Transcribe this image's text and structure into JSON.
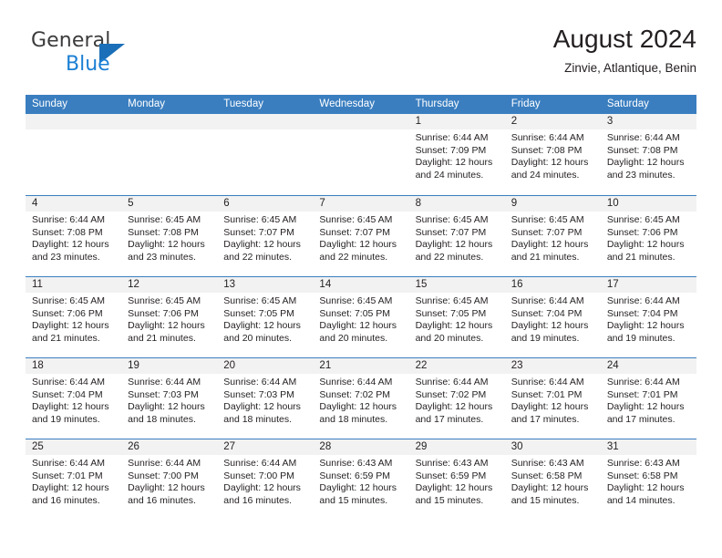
{
  "brand": {
    "name_part1": "General",
    "name_part2": "Blue",
    "accent_color": "#1b7fd4",
    "triangle_color": "#1b6fb8"
  },
  "header": {
    "title": "August 2024",
    "subtitle": "Zinvie, Atlantique, Benin"
  },
  "calendar": {
    "header_bg": "#3a7ec0",
    "weekdays": [
      "Sunday",
      "Monday",
      "Tuesday",
      "Wednesday",
      "Thursday",
      "Friday",
      "Saturday"
    ],
    "weeks": [
      [
        {
          "day": "",
          "empty": true,
          "sunrise": "",
          "sunset": "",
          "daylight1": "",
          "daylight2": ""
        },
        {
          "day": "",
          "empty": true,
          "sunrise": "",
          "sunset": "",
          "daylight1": "",
          "daylight2": ""
        },
        {
          "day": "",
          "empty": true,
          "sunrise": "",
          "sunset": "",
          "daylight1": "",
          "daylight2": ""
        },
        {
          "day": "",
          "empty": true,
          "sunrise": "",
          "sunset": "",
          "daylight1": "",
          "daylight2": ""
        },
        {
          "day": "1",
          "sunrise": "Sunrise: 6:44 AM",
          "sunset": "Sunset: 7:09 PM",
          "daylight1": "Daylight: 12 hours",
          "daylight2": "and 24 minutes."
        },
        {
          "day": "2",
          "sunrise": "Sunrise: 6:44 AM",
          "sunset": "Sunset: 7:08 PM",
          "daylight1": "Daylight: 12 hours",
          "daylight2": "and 24 minutes."
        },
        {
          "day": "3",
          "sunrise": "Sunrise: 6:44 AM",
          "sunset": "Sunset: 7:08 PM",
          "daylight1": "Daylight: 12 hours",
          "daylight2": "and 23 minutes."
        }
      ],
      [
        {
          "day": "4",
          "sunrise": "Sunrise: 6:44 AM",
          "sunset": "Sunset: 7:08 PM",
          "daylight1": "Daylight: 12 hours",
          "daylight2": "and 23 minutes."
        },
        {
          "day": "5",
          "sunrise": "Sunrise: 6:45 AM",
          "sunset": "Sunset: 7:08 PM",
          "daylight1": "Daylight: 12 hours",
          "daylight2": "and 23 minutes."
        },
        {
          "day": "6",
          "sunrise": "Sunrise: 6:45 AM",
          "sunset": "Sunset: 7:07 PM",
          "daylight1": "Daylight: 12 hours",
          "daylight2": "and 22 minutes."
        },
        {
          "day": "7",
          "sunrise": "Sunrise: 6:45 AM",
          "sunset": "Sunset: 7:07 PM",
          "daylight1": "Daylight: 12 hours",
          "daylight2": "and 22 minutes."
        },
        {
          "day": "8",
          "sunrise": "Sunrise: 6:45 AM",
          "sunset": "Sunset: 7:07 PM",
          "daylight1": "Daylight: 12 hours",
          "daylight2": "and 22 minutes."
        },
        {
          "day": "9",
          "sunrise": "Sunrise: 6:45 AM",
          "sunset": "Sunset: 7:07 PM",
          "daylight1": "Daylight: 12 hours",
          "daylight2": "and 21 minutes."
        },
        {
          "day": "10",
          "sunrise": "Sunrise: 6:45 AM",
          "sunset": "Sunset: 7:06 PM",
          "daylight1": "Daylight: 12 hours",
          "daylight2": "and 21 minutes."
        }
      ],
      [
        {
          "day": "11",
          "sunrise": "Sunrise: 6:45 AM",
          "sunset": "Sunset: 7:06 PM",
          "daylight1": "Daylight: 12 hours",
          "daylight2": "and 21 minutes."
        },
        {
          "day": "12",
          "sunrise": "Sunrise: 6:45 AM",
          "sunset": "Sunset: 7:06 PM",
          "daylight1": "Daylight: 12 hours",
          "daylight2": "and 21 minutes."
        },
        {
          "day": "13",
          "sunrise": "Sunrise: 6:45 AM",
          "sunset": "Sunset: 7:05 PM",
          "daylight1": "Daylight: 12 hours",
          "daylight2": "and 20 minutes."
        },
        {
          "day": "14",
          "sunrise": "Sunrise: 6:45 AM",
          "sunset": "Sunset: 7:05 PM",
          "daylight1": "Daylight: 12 hours",
          "daylight2": "and 20 minutes."
        },
        {
          "day": "15",
          "sunrise": "Sunrise: 6:45 AM",
          "sunset": "Sunset: 7:05 PM",
          "daylight1": "Daylight: 12 hours",
          "daylight2": "and 20 minutes."
        },
        {
          "day": "16",
          "sunrise": "Sunrise: 6:44 AM",
          "sunset": "Sunset: 7:04 PM",
          "daylight1": "Daylight: 12 hours",
          "daylight2": "and 19 minutes."
        },
        {
          "day": "17",
          "sunrise": "Sunrise: 6:44 AM",
          "sunset": "Sunset: 7:04 PM",
          "daylight1": "Daylight: 12 hours",
          "daylight2": "and 19 minutes."
        }
      ],
      [
        {
          "day": "18",
          "sunrise": "Sunrise: 6:44 AM",
          "sunset": "Sunset: 7:04 PM",
          "daylight1": "Daylight: 12 hours",
          "daylight2": "and 19 minutes."
        },
        {
          "day": "19",
          "sunrise": "Sunrise: 6:44 AM",
          "sunset": "Sunset: 7:03 PM",
          "daylight1": "Daylight: 12 hours",
          "daylight2": "and 18 minutes."
        },
        {
          "day": "20",
          "sunrise": "Sunrise: 6:44 AM",
          "sunset": "Sunset: 7:03 PM",
          "daylight1": "Daylight: 12 hours",
          "daylight2": "and 18 minutes."
        },
        {
          "day": "21",
          "sunrise": "Sunrise: 6:44 AM",
          "sunset": "Sunset: 7:02 PM",
          "daylight1": "Daylight: 12 hours",
          "daylight2": "and 18 minutes."
        },
        {
          "day": "22",
          "sunrise": "Sunrise: 6:44 AM",
          "sunset": "Sunset: 7:02 PM",
          "daylight1": "Daylight: 12 hours",
          "daylight2": "and 17 minutes."
        },
        {
          "day": "23",
          "sunrise": "Sunrise: 6:44 AM",
          "sunset": "Sunset: 7:01 PM",
          "daylight1": "Daylight: 12 hours",
          "daylight2": "and 17 minutes."
        },
        {
          "day": "24",
          "sunrise": "Sunrise: 6:44 AM",
          "sunset": "Sunset: 7:01 PM",
          "daylight1": "Daylight: 12 hours",
          "daylight2": "and 17 minutes."
        }
      ],
      [
        {
          "day": "25",
          "sunrise": "Sunrise: 6:44 AM",
          "sunset": "Sunset: 7:01 PM",
          "daylight1": "Daylight: 12 hours",
          "daylight2": "and 16 minutes."
        },
        {
          "day": "26",
          "sunrise": "Sunrise: 6:44 AM",
          "sunset": "Sunset: 7:00 PM",
          "daylight1": "Daylight: 12 hours",
          "daylight2": "and 16 minutes."
        },
        {
          "day": "27",
          "sunrise": "Sunrise: 6:44 AM",
          "sunset": "Sunset: 7:00 PM",
          "daylight1": "Daylight: 12 hours",
          "daylight2": "and 16 minutes."
        },
        {
          "day": "28",
          "sunrise": "Sunrise: 6:43 AM",
          "sunset": "Sunset: 6:59 PM",
          "daylight1": "Daylight: 12 hours",
          "daylight2": "and 15 minutes."
        },
        {
          "day": "29",
          "sunrise": "Sunrise: 6:43 AM",
          "sunset": "Sunset: 6:59 PM",
          "daylight1": "Daylight: 12 hours",
          "daylight2": "and 15 minutes."
        },
        {
          "day": "30",
          "sunrise": "Sunrise: 6:43 AM",
          "sunset": "Sunset: 6:58 PM",
          "daylight1": "Daylight: 12 hours",
          "daylight2": "and 15 minutes."
        },
        {
          "day": "31",
          "sunrise": "Sunrise: 6:43 AM",
          "sunset": "Sunset: 6:58 PM",
          "daylight1": "Daylight: 12 hours",
          "daylight2": "and 14 minutes."
        }
      ]
    ]
  }
}
